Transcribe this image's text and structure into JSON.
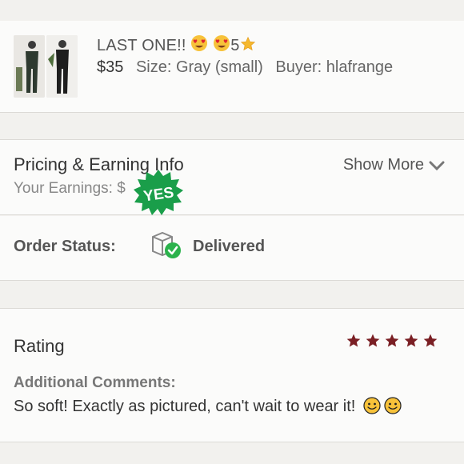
{
  "item": {
    "title": "LAST ONE!!",
    "title_suffix": "5",
    "price": "$35",
    "size": "Size: Gray (small)",
    "buyer": "Buyer: hlafrange"
  },
  "pricing": {
    "title": "Pricing & Earning Info",
    "earnings_label": "Your Earnings: $",
    "show_more_label": "Show More",
    "sticker_text": "YES"
  },
  "order": {
    "label": "Order Status:",
    "value": "Delivered"
  },
  "rating": {
    "label": "Rating",
    "stars": 5,
    "comments_label": "Additional Comments:",
    "comments_text": "So soft! Exactly as pictured, can't wait to wear it!"
  },
  "colors": {
    "star": "#7a1f24",
    "sticker": "#1a9e4a",
    "check": "#2bb24c",
    "background": "#f2f1ee",
    "card": "#fbfbfa"
  }
}
